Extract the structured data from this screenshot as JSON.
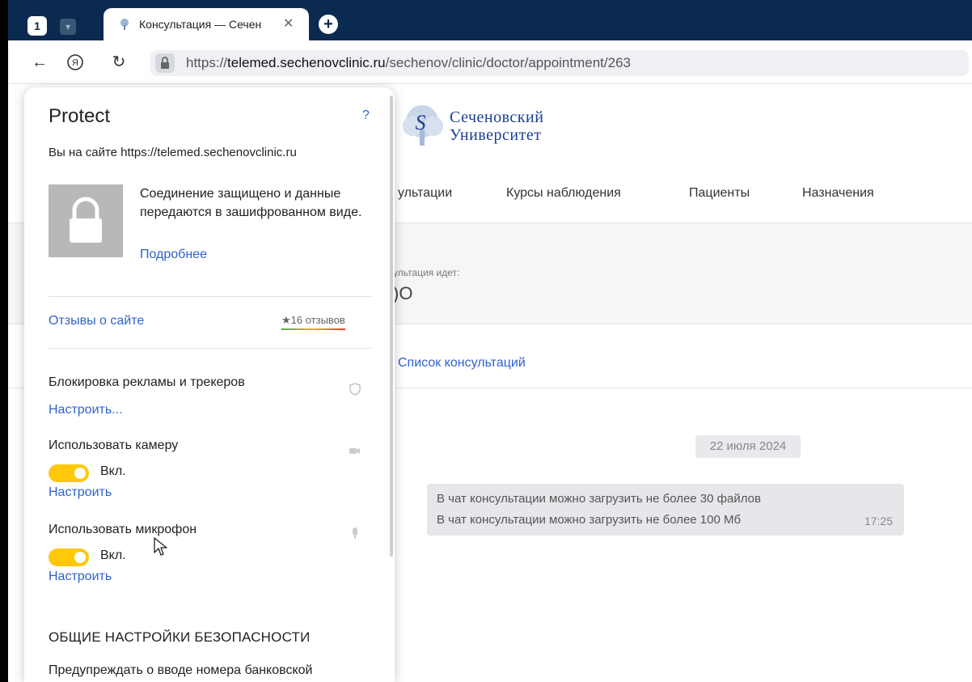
{
  "browser": {
    "tab_count": "1",
    "tab_title": "Консультация — Сечен",
    "url_host": "telemed.sechenovclinic.ru",
    "url_scheme": "https://",
    "url_path": "/sechenov/clinic/doctor/appointment/263"
  },
  "page": {
    "logo_line1": "Сеченовский",
    "logo_line2": "Университет",
    "nav": [
      "ультации",
      "Курсы наблюдения",
      "Пациенты",
      "Назначения"
    ],
    "status_label": "ультация идет:",
    "status_value": ")O",
    "consult_list_link": "Список консультаций",
    "date_chip": "22 июля 2024",
    "chat": {
      "line1": "В чат консультации можно загрузить не более 30 файлов",
      "line2": "В чат консультации можно загрузить не более 100 Мб",
      "time": "17:25"
    }
  },
  "protect": {
    "title": "Protect",
    "help": "?",
    "site_text": "Вы на сайте https://telemed.sechenovclinic.ru",
    "secure_text": "Соединение защищено и данные передаются в зашифрованном виде.",
    "more_link": "Подробнее",
    "reviews_link": "Отзывы о сайте",
    "reviews_count": "★16 отзывов",
    "ads_block_label": "Блокировка рекламы и трекеров",
    "ads_block_link": "Настроить...",
    "camera_label": "Использовать камеру",
    "camera_toggle": "Вкл.",
    "camera_link": "Настроить",
    "mic_label": "Использовать микрофон",
    "mic_toggle": "Вкл.",
    "mic_link": "Настроить",
    "general_title": "ОБЩИЕ НАСТРОЙКИ БЕЗОПАСНОСТИ",
    "bank_warn": "Предупреждать о вводе номера банковской"
  },
  "colors": {
    "tabbar": "#0b2a4f",
    "link": "#2f63c8",
    "toggle_on": "#ffc90a",
    "logo": "#1b3f8f"
  }
}
